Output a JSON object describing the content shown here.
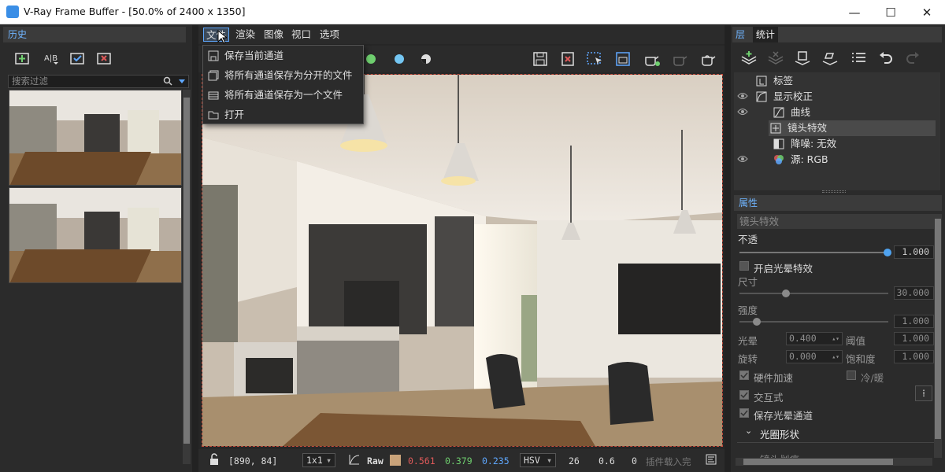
{
  "window": {
    "title": "V-Ray Frame Buffer - [50.0% of 2400 x 1350]",
    "minimize": "—",
    "maximize": "☐",
    "close": "✕"
  },
  "history": {
    "header": "历史",
    "filter_placeholder": "搜索过滤"
  },
  "menu": {
    "file": "文件",
    "render": "渲染",
    "image": "图像",
    "view": "视口",
    "options": "选项"
  },
  "file_menu": {
    "items": [
      "保存当前通道",
      "将所有通道保存为分开的文件",
      "将所有通道保存为一个文件",
      "打开"
    ]
  },
  "status": {
    "coords": "[890, 84]",
    "zoom": "1x1",
    "color_mode": "Raw",
    "r": "0.561",
    "g": "0.379",
    "b": "0.235",
    "colorspace": "HSV",
    "h": "26",
    "s": "0.6",
    "v": "0",
    "plugin": "插件载入完"
  },
  "colors": {
    "accent": "#3a8ee6",
    "r": "#e05a5a",
    "g": "#6fcf6f",
    "b": "#5fa8ff",
    "swatch": "#c9a37a"
  },
  "layers": {
    "tab_layers": "层",
    "tab_stats": "统计",
    "items": [
      {
        "label": "标签",
        "eye": false
      },
      {
        "label": "显示校正",
        "eye": true
      },
      {
        "label": "曲线",
        "eye": true
      },
      {
        "label": "镜头特效",
        "eye": false,
        "selected": true
      },
      {
        "label": "降噪: 无效",
        "eye": false
      },
      {
        "label": "源: RGB",
        "eye": true
      }
    ]
  },
  "properties": {
    "header": "属性",
    "section": "镜头特效",
    "opacity_label": "不透",
    "opacity_value": "1.000",
    "opacity_level": 1.0,
    "glare_enable": "开启光晕特效",
    "size_label": "尺寸",
    "size_value": "30.000",
    "size_level": 0.3,
    "intensity_label": "强度",
    "intensity_value": "1.000",
    "intensity_level": 0.1,
    "bloom_label": "光晕",
    "bloom_value": "0.400",
    "threshold_label": "阈值",
    "threshold_value": "1.000",
    "rotation_label": "旋转",
    "rotation_value": "0.000",
    "saturation_label": "饱和度",
    "saturation_value": "1.000",
    "hw_accel": "硬件加速",
    "cold_warm": "冷/暖",
    "interactive": "交互式",
    "save_glare": "保存光晕通道",
    "aperture": "光圈形状",
    "next_section": "镜头划痕"
  }
}
